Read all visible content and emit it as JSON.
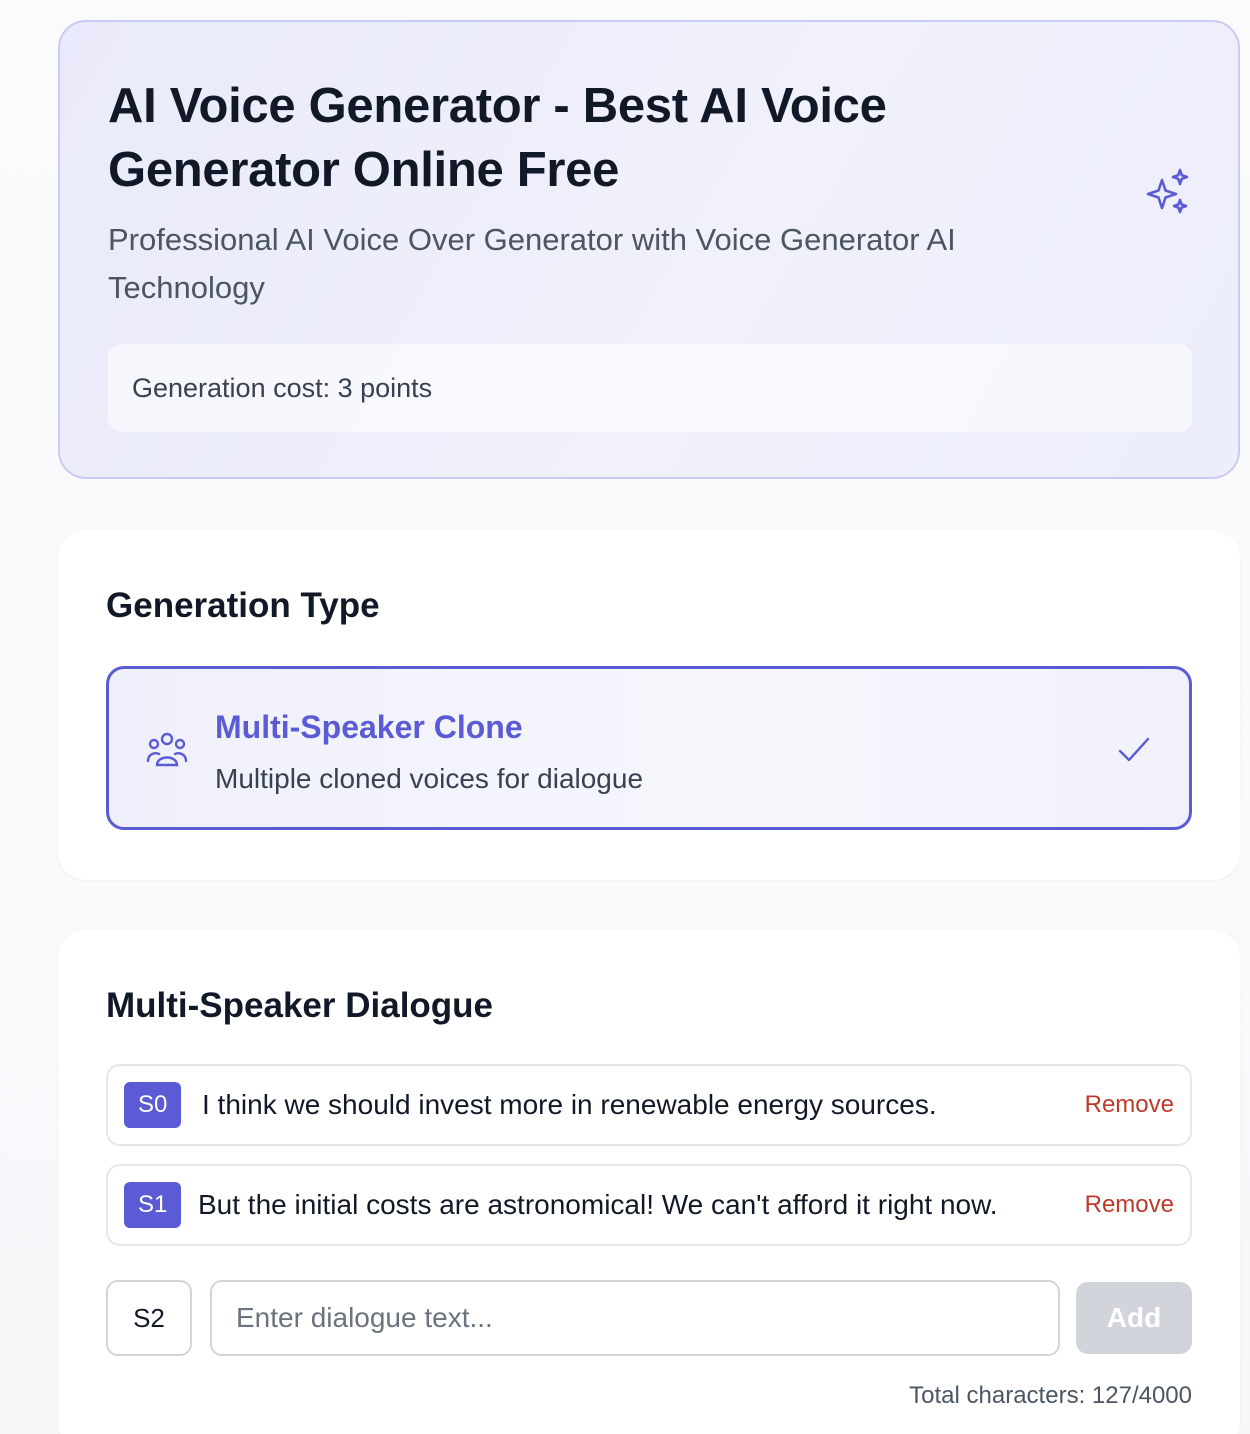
{
  "hero": {
    "title": "AI Voice Generator - Best AI Voice Generator Online Free",
    "subtitle": "Professional AI Voice Over Generator with Voice Generator AI Technology",
    "cost": "Generation cost: 3 points",
    "icon": "sparkles-icon"
  },
  "generation_type": {
    "title": "Generation Type",
    "selected": {
      "name": "Multi-Speaker Clone",
      "description": "Multiple cloned voices for dialogue",
      "icon": "users-icon",
      "check_icon": "check-icon"
    }
  },
  "dialogue": {
    "title": "Multi-Speaker Dialogue",
    "lines": [
      {
        "speaker": "S0",
        "text": "I think we should invest more in renewable energy sources.",
        "remove_label": "Remove"
      },
      {
        "speaker": "S1",
        "text": "But the initial costs are astronomical! We can't afford it right now.",
        "remove_label": "Remove"
      }
    ],
    "new_speaker": "S2",
    "input_placeholder": "Enter dialogue text...",
    "add_label": "Add",
    "char_count": "Total characters: 127/4000"
  },
  "colors": {
    "accent": "#5b5bd6",
    "remove": "#c0392b",
    "disabled": "#d1d5db"
  }
}
